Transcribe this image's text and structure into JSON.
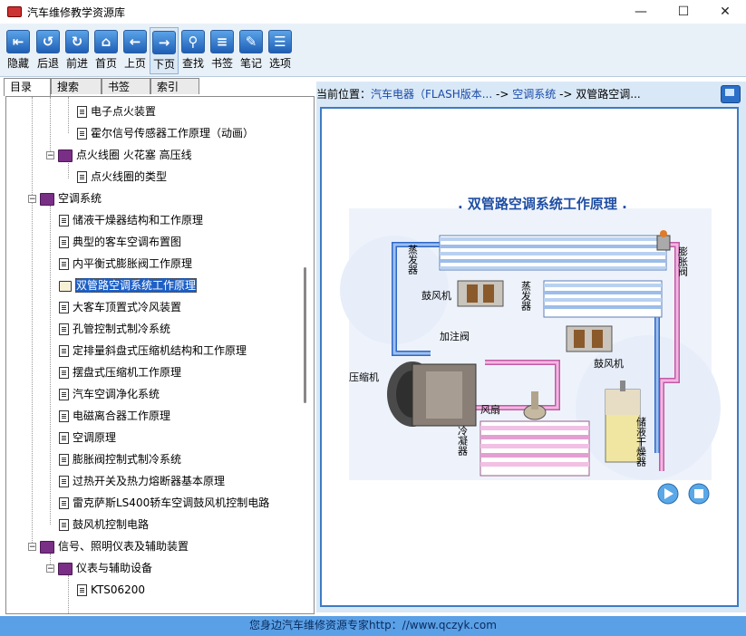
{
  "window": {
    "title": "汽车维修教学资源库",
    "min_icon": "minimize-icon",
    "max_icon": "maximize-icon",
    "close_icon": "close-icon"
  },
  "toolbar": {
    "buttons": [
      {
        "label": "隐藏",
        "icon": "hide-icon",
        "glyph": "⇤"
      },
      {
        "label": "后退",
        "icon": "back-icon",
        "glyph": "↺"
      },
      {
        "label": "前进",
        "icon": "forward-icon",
        "glyph": "↻"
      },
      {
        "label": "首页",
        "icon": "home-icon",
        "glyph": "⌂"
      },
      {
        "label": "上页",
        "icon": "prev-page-icon",
        "glyph": "←"
      },
      {
        "label": "下页",
        "icon": "next-page-icon",
        "glyph": "→"
      },
      {
        "label": "查找",
        "icon": "search-icon",
        "glyph": "⚲"
      },
      {
        "label": "书签",
        "icon": "bookmark-icon",
        "glyph": "≡"
      },
      {
        "label": "笔记",
        "icon": "notes-icon",
        "glyph": "✎"
      },
      {
        "label": "选项",
        "icon": "options-icon",
        "glyph": "☰"
      }
    ]
  },
  "tabs": [
    "目录",
    "搜索",
    "书签",
    "索引"
  ],
  "tree": [
    {
      "label": "电子点火装置"
    },
    {
      "label": "霍尔信号传感器工作原理（动画）"
    },
    {
      "label": "点火线圈 火花塞 高压线"
    },
    {
      "label": "点火线圈的类型"
    },
    {
      "label": "空调系统"
    },
    {
      "label": "储液干燥器结构和工作原理"
    },
    {
      "label": "典型的客车空调布置图"
    },
    {
      "label": "内平衡式膨胀阀工作原理"
    },
    {
      "label": "双管路空调系统工作原理"
    },
    {
      "label": "大客车顶置式冷风装置"
    },
    {
      "label": "孔管控制式制冷系统"
    },
    {
      "label": "定排量斜盘式压缩机结构和工作原理"
    },
    {
      "label": "摆盘式压缩机工作原理"
    },
    {
      "label": "汽车空调净化系统"
    },
    {
      "label": "电磁离合器工作原理"
    },
    {
      "label": "空调原理"
    },
    {
      "label": "膨胀阀控制式制冷系统"
    },
    {
      "label": "过热开关及热力熔断器基本原理"
    },
    {
      "label": "雷克萨斯LS400轿车空调鼓风机控制电路"
    },
    {
      "label": "鼓风机控制电路"
    },
    {
      "label": "信号、照明仪表及辅助装置"
    },
    {
      "label": "仪表与辅助设备"
    },
    {
      "label": "KTS06200"
    }
  ],
  "location": {
    "label": "当前位置：",
    "link1": "汽车电器（FLASH版本...",
    "sep": "->",
    "link2": "空调系统",
    "current": "双管路空调..."
  },
  "diagram": {
    "title": ". 双管路空调系统工作原理 .",
    "labels": {
      "evap1": "蒸发器",
      "evap2": "蒸发器",
      "blower1": "鼓风机",
      "blower2": "鼓风机",
      "valve": "膨胀阀",
      "charge": "加注阀",
      "compressor": "压缩机",
      "fan": "风扇",
      "condenser": "冷凝器",
      "receiver": "储液干燥器"
    }
  },
  "status": {
    "text": "您身边汽车维修资源专家http：//www.qczyk.com"
  }
}
